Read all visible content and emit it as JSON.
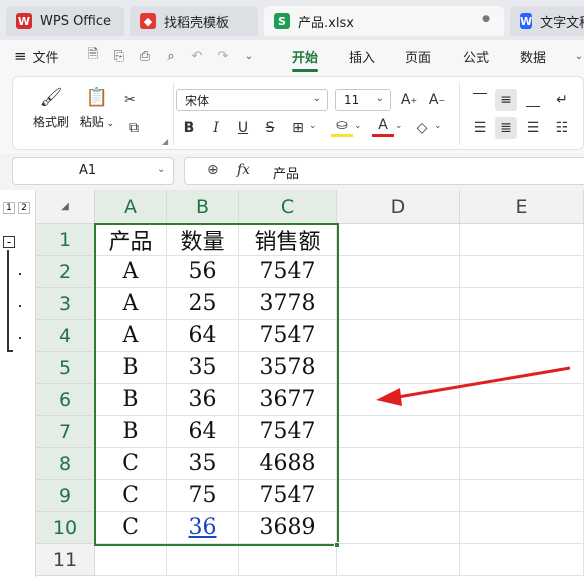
{
  "tabs": [
    {
      "label": "WPS Office",
      "icon": "wps-logo-icon",
      "color": "#d32f2f"
    },
    {
      "label": "找稻壳模板",
      "icon": "docer-icon",
      "color": "#e53935"
    },
    {
      "label": "产品.xlsx",
      "icon": "sheet-icon",
      "color": "#1f9d55",
      "icon_letter": "S",
      "modified_dot": "●"
    },
    {
      "label": "文字文稿",
      "icon": "writer-icon",
      "color": "#2962ff",
      "icon_letter": "W"
    }
  ],
  "menu": {
    "file": "文件",
    "items": [
      "开始",
      "插入",
      "页面",
      "公式",
      "数据"
    ],
    "active": "开始",
    "accent": "#1f7a3f"
  },
  "ribbon": {
    "format_painter": "格式刷",
    "paste": "粘贴",
    "font_name": "宋体",
    "font_size": "11"
  },
  "formula_bar": {
    "cell_ref": "A1",
    "fx": "fx",
    "content": "产品"
  },
  "outline_levels": [
    "1",
    "2"
  ],
  "columns": [
    "A",
    "B",
    "C",
    "D",
    "E"
  ],
  "rows": [
    {
      "num": "1",
      "cells": [
        "产品",
        "数量",
        "销售额"
      ]
    },
    {
      "num": "2",
      "cells": [
        "A",
        "56",
        "7547"
      ]
    },
    {
      "num": "3",
      "cells": [
        "A",
        "25",
        "3778"
      ]
    },
    {
      "num": "4",
      "cells": [
        "A",
        "64",
        "7547"
      ]
    },
    {
      "num": "5",
      "cells": [
        "B",
        "35",
        "3578"
      ]
    },
    {
      "num": "6",
      "cells": [
        "B",
        "36",
        "3677"
      ]
    },
    {
      "num": "7",
      "cells": [
        "B",
        "64",
        "7547"
      ]
    },
    {
      "num": "8",
      "cells": [
        "C",
        "35",
        "4688"
      ]
    },
    {
      "num": "9",
      "cells": [
        "C",
        "75",
        "7547"
      ]
    },
    {
      "num": "10",
      "cells": [
        "C",
        "36",
        "3689"
      ]
    },
    {
      "num": "11",
      "cells": [
        "",
        "",
        ""
      ]
    }
  ],
  "annotation_arrow_color": "#e02020"
}
